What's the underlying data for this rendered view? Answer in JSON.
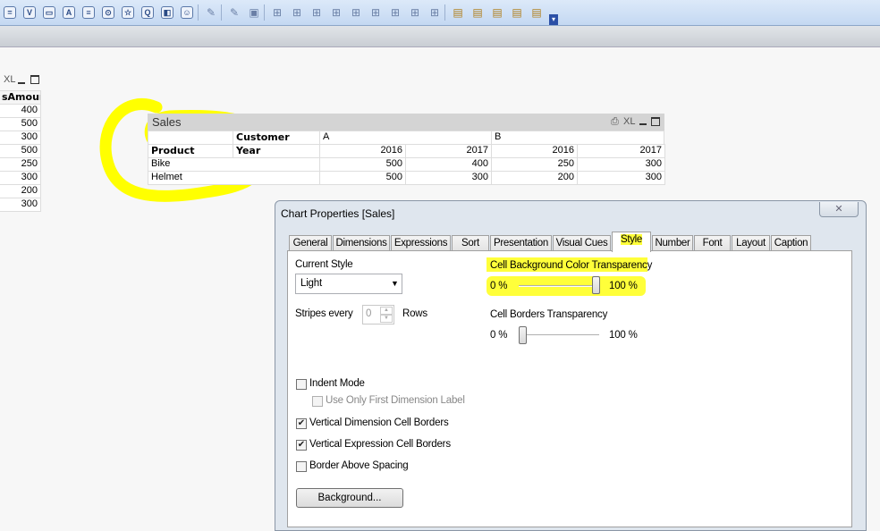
{
  "toolbar": {
    "icons": [
      "list-box-icon",
      "multi-box-icon",
      "table-box-icon",
      "text-object-icon",
      "input-box-icon",
      "current-selections-icon",
      "bookmark-icon",
      "search-object-icon",
      "container-icon",
      "slider-icon",
      "wizard-icon",
      "clear-icon",
      "lock-icon",
      "align-left-icon",
      "align-center-icon",
      "align-right-icon",
      "distribute-icon",
      "space-icon",
      "top-align-icon",
      "adjust-icon",
      "stretch-icon",
      "arrange-icon",
      "sheet-props-icon",
      "new-sheet-icon",
      "edit-script-icon",
      "table-viewer-icon",
      "doc-props-icon",
      "overflow-icon"
    ]
  },
  "left_table": {
    "caption_xl": "XL",
    "header": "sAmount",
    "values": [
      "400",
      "500",
      "300",
      "500",
      "250",
      "300",
      "200",
      "300"
    ]
  },
  "sales": {
    "title": "Sales",
    "caption_xl": "XL",
    "dim1": "Customer",
    "dim2": "Year",
    "row_header": "Product",
    "customers": [
      "A",
      "B"
    ],
    "years": [
      "2016",
      "2017",
      "2016",
      "2017"
    ],
    "rows": [
      {
        "product": "Bike",
        "values": [
          "500",
          "400",
          "250",
          "300"
        ]
      },
      {
        "product": "Helmet",
        "values": [
          "500",
          "300",
          "200",
          "300"
        ]
      }
    ]
  },
  "dialog": {
    "title": "Chart Properties [Sales]",
    "close": "✕",
    "tabs": [
      "General",
      "Dimensions",
      "Expressions",
      "Sort",
      "Presentation",
      "Visual Cues",
      "Style",
      "Number",
      "Font",
      "Layout",
      "Caption"
    ],
    "active_tab": "Style",
    "current_style_label": "Current Style",
    "current_style_value": "Light",
    "stripes_label": "Stripes every",
    "stripes_value": "0",
    "rows_label": "Rows",
    "bg_transparency_label": "Cell Background Color Transparency",
    "bg_min": "0 %",
    "bg_max": "100 %",
    "bg_value_percent": 100,
    "border_transparency_label": "Cell Borders Transparency",
    "border_min": "0 %",
    "border_max": "100 %",
    "border_value_percent": 0,
    "checkboxes": [
      {
        "label": "Indent Mode",
        "checked": false
      },
      {
        "label": "Use Only First Dimension Label",
        "checked": false,
        "disabled": true
      },
      {
        "label": "Vertical Dimension Cell Borders",
        "checked": true
      },
      {
        "label": "Vertical Expression Cell Borders",
        "checked": true
      },
      {
        "label": "Border Above Spacing",
        "checked": false
      }
    ],
    "background_button": "Background..."
  },
  "highlight_color": "#ffff00"
}
